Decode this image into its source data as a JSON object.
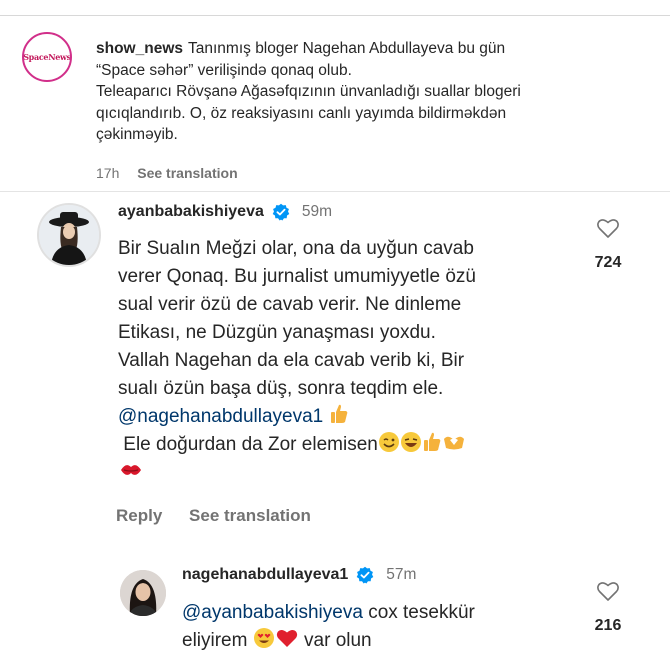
{
  "caption": {
    "username": "show_news",
    "line1": "Tanınmış bloger Nagehan Abdullayeva bu gün",
    "line2": "“Space səhər” verilişində qonaq olub.",
    "line3": "Teleaparıcı Rövşanə Ağasəfqızının ünvanladığı suallar blogeri",
    "line4": "qıcıqlandırıb. O, öz reaksiyasını canlı yayımda bildirməkdən",
    "line5": "çəkinməyib.",
    "time": "17h",
    "see_translation": "See translation",
    "avatar_logo": "SpaceNews"
  },
  "comment1": {
    "username": "ayanbabakishiyeva",
    "time": "59m",
    "lines": [
      "Bir Sualın Meğzi olar, ona da uyğun cavab",
      "verer Qonaq. Bu jurnalist umumiyyetle özü",
      "sual verir özü de cavab verir. Ne dinleme",
      "Etikası, ne Düzgün yanaşması yoxdu.",
      "Vallah Nagehan da ela cavab verib ki, Bir",
      "sualı özün başa düş, sonra teqdim ele."
    ],
    "mention": "@nagehanabdullayeva1",
    "last_line": "Ele doğurdan da Zor elemisen",
    "likes": "724",
    "reply": "Reply",
    "see_translation": "See translation"
  },
  "comment2": {
    "username": "nagehanabdullayeva1",
    "time": "57m",
    "mention": "@ayanbabakishiyeva",
    "text1": "cox tesekkür",
    "text2a": "eliyirem",
    "text2b": "var olun",
    "likes": "216"
  },
  "colors": {
    "mention": "#00376b",
    "verified": "#0095f6",
    "muted": "#737373"
  }
}
